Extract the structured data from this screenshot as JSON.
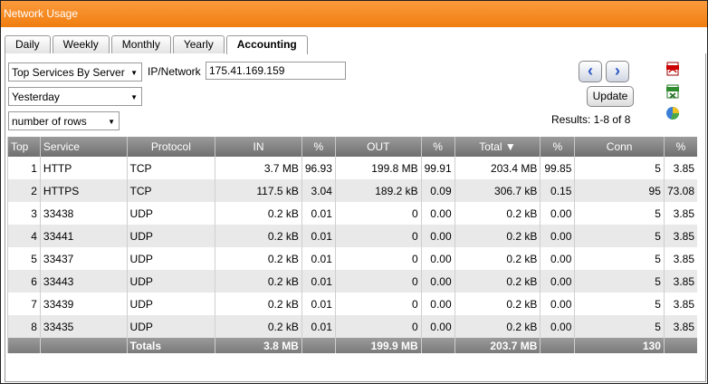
{
  "window": {
    "title": "Network Usage"
  },
  "tabs": [
    "Daily",
    "Weekly",
    "Monthly",
    "Yearly",
    "Accounting"
  ],
  "active_tab": "Accounting",
  "filters": {
    "report": "Top Services By Server",
    "period": "Yesterday",
    "rows": "number of rows",
    "ip_label": "IP/Network",
    "ip_value": "175.41.169.159"
  },
  "controls": {
    "update_label": "Update",
    "results": "Results: 1-8 of 8"
  },
  "table": {
    "headers": [
      "Top",
      "Service",
      "Protocol",
      "IN",
      "%",
      "OUT",
      "%",
      "Total",
      "%",
      "Conn",
      "%"
    ],
    "rows": [
      [
        "1",
        "HTTP",
        "TCP",
        "3.7 MB",
        "96.93",
        "199.8 MB",
        "99.91",
        "203.4 MB",
        "99.85",
        "5",
        "3.85"
      ],
      [
        "2",
        "HTTPS",
        "TCP",
        "117.5 kB",
        "3.04",
        "189.2 kB",
        "0.09",
        "306.7 kB",
        "0.15",
        "95",
        "73.08"
      ],
      [
        "3",
        "33438",
        "UDP",
        "0.2 kB",
        "0.01",
        "0",
        "0.00",
        "0.2 kB",
        "0.00",
        "5",
        "3.85"
      ],
      [
        "4",
        "33441",
        "UDP",
        "0.2 kB",
        "0.01",
        "0",
        "0.00",
        "0.2 kB",
        "0.00",
        "5",
        "3.85"
      ],
      [
        "5",
        "33437",
        "UDP",
        "0.2 kB",
        "0.01",
        "0",
        "0.00",
        "0.2 kB",
        "0.00",
        "5",
        "3.85"
      ],
      [
        "6",
        "33443",
        "UDP",
        "0.2 kB",
        "0.01",
        "0",
        "0.00",
        "0.2 kB",
        "0.00",
        "5",
        "3.85"
      ],
      [
        "7",
        "33439",
        "UDP",
        "0.2 kB",
        "0.01",
        "0",
        "0.00",
        "0.2 kB",
        "0.00",
        "5",
        "3.85"
      ],
      [
        "8",
        "33435",
        "UDP",
        "0.2 kB",
        "0.01",
        "0",
        "0.00",
        "0.2 kB",
        "0.00",
        "5",
        "3.85"
      ]
    ],
    "totals": [
      "",
      "",
      "Totals",
      "3.8 MB",
      "",
      "199.9 MB",
      "",
      "203.7 MB",
      "",
      "130",
      ""
    ]
  },
  "icons": [
    "pdf-icon",
    "xls-icon",
    "pie-chart-icon",
    "arrow-left-icon",
    "arrow-right-icon"
  ],
  "colors": {
    "titlebar": "#f07e10",
    "header": "#7a7a7a"
  }
}
